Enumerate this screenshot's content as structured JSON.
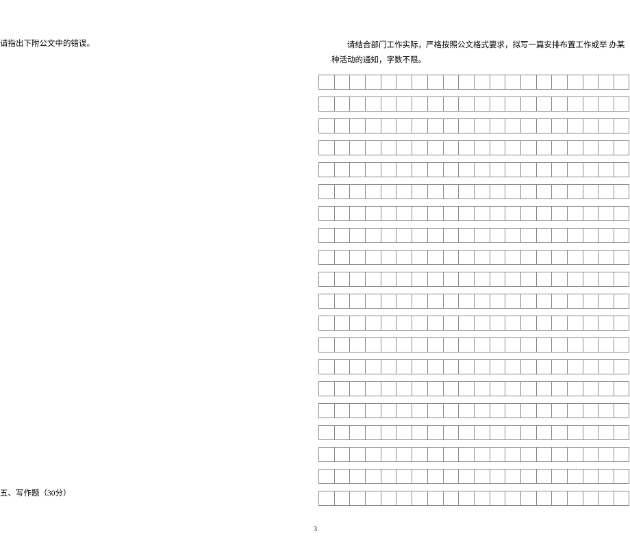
{
  "leftInstruction": "请指出下附公文中的错误。",
  "rightInstruction": "请结合部门工作实际，严格按照公文格式要求，拟写一篇安排布置工作或举  办某种活动的通知，字数不限。",
  "sectionTitle": "五、写作题（30分）",
  "pageNumber": "3",
  "grid": {
    "rows": 20,
    "cols": 20
  }
}
